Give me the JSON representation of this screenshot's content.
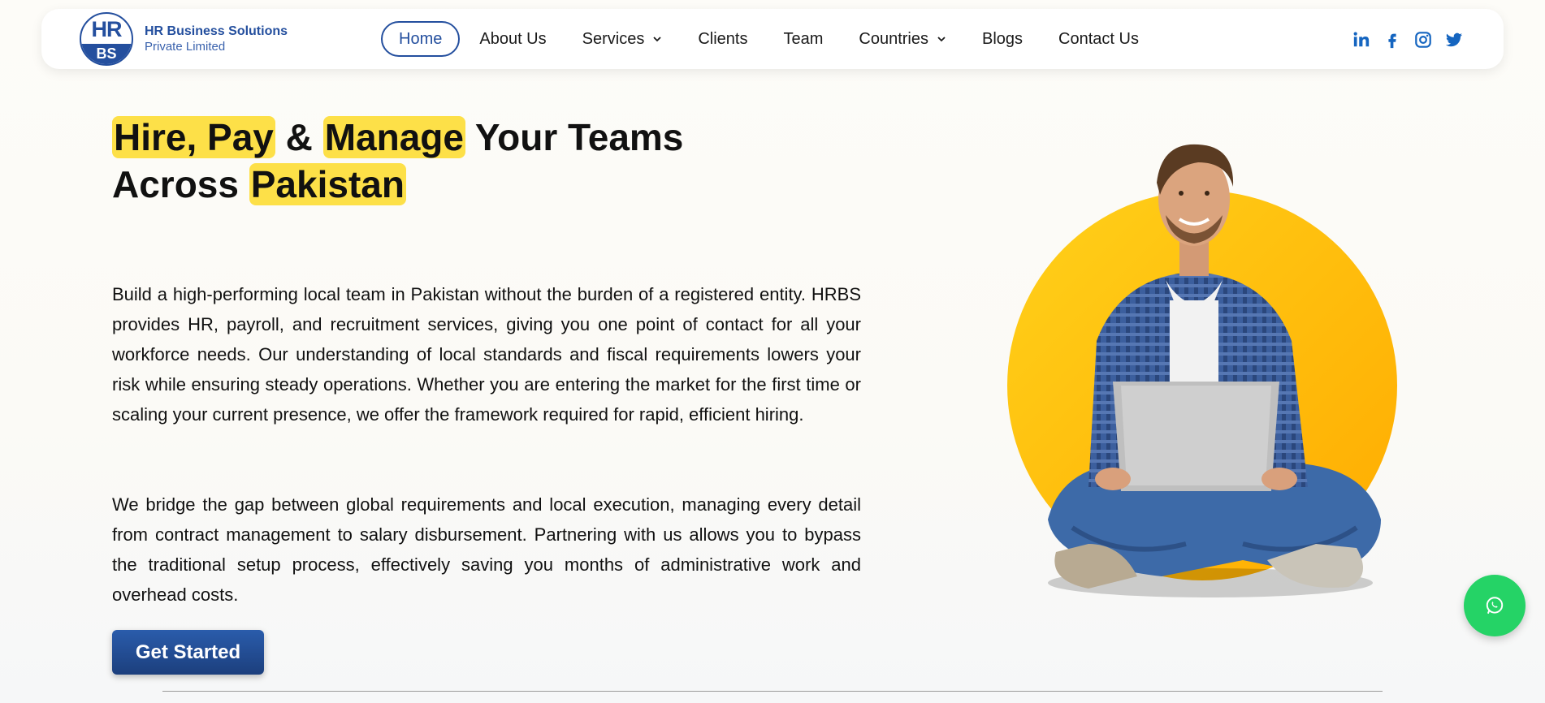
{
  "brand": {
    "logo_top": "HR",
    "logo_bottom": "BS",
    "name": "HR Business Solutions",
    "tagline": "Private Limited",
    "primary_color": "#244f9e"
  },
  "nav": {
    "items": [
      {
        "label": "Home",
        "active": true
      },
      {
        "label": "About Us"
      },
      {
        "label": "Services",
        "dropdown": true
      },
      {
        "label": "Clients"
      },
      {
        "label": "Team"
      },
      {
        "label": "Countries",
        "dropdown": true
      },
      {
        "label": "Blogs"
      },
      {
        "label": "Contact Us"
      }
    ]
  },
  "socials": [
    "linkedin-icon",
    "facebook-icon",
    "instagram-icon",
    "twitter-icon"
  ],
  "hero": {
    "headline": {
      "hl1": "Hire, Pay",
      "amp": " & ",
      "hl2": "Manage",
      "rest": " Your Teams Across ",
      "hl3": "Pakistan"
    },
    "paragraph1": "Build a high-performing local team in Pakistan without the burden of a registered entity. HRBS provides HR, payroll, and recruitment services, giving you one point of contact for all your workforce needs. Our understanding of local standards and fiscal requirements lowers your risk while ensuring steady operations. Whether you are entering the market for the first time or scaling your current presence, we offer the framework required for rapid, efficient hiring.",
    "paragraph2": "We bridge the gap between global requirements and local execution, managing every detail from contract management to salary disbursement. Partnering with us allows you to bypass the traditional setup process, effectively saving you months of administrative work and overhead costs.",
    "cta_label": "Get Started",
    "highlight_color": "#fde048"
  },
  "floating": {
    "whatsapp_icon": "whatsapp-icon",
    "color": "#25d366"
  }
}
